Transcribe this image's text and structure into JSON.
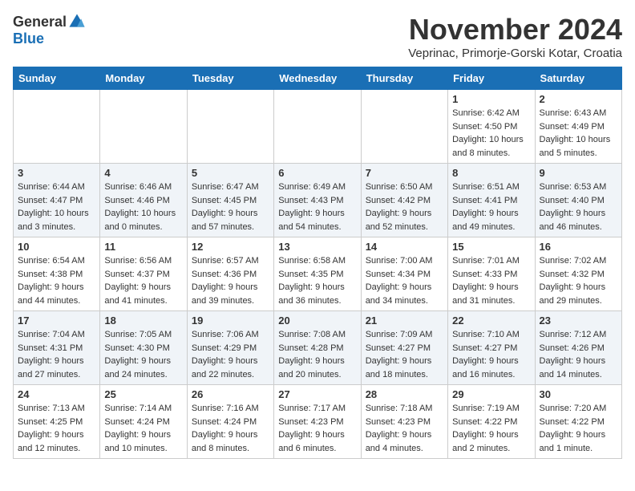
{
  "logo": {
    "general": "General",
    "blue": "Blue"
  },
  "title": "November 2024",
  "location": "Veprinac, Primorje-Gorski Kotar, Croatia",
  "days_header": [
    "Sunday",
    "Monday",
    "Tuesday",
    "Wednesday",
    "Thursday",
    "Friday",
    "Saturday"
  ],
  "weeks": [
    [
      {
        "day": "",
        "info": ""
      },
      {
        "day": "",
        "info": ""
      },
      {
        "day": "",
        "info": ""
      },
      {
        "day": "",
        "info": ""
      },
      {
        "day": "",
        "info": ""
      },
      {
        "day": "1",
        "info": "Sunrise: 6:42 AM\nSunset: 4:50 PM\nDaylight: 10 hours and 8 minutes."
      },
      {
        "day": "2",
        "info": "Sunrise: 6:43 AM\nSunset: 4:49 PM\nDaylight: 10 hours and 5 minutes."
      }
    ],
    [
      {
        "day": "3",
        "info": "Sunrise: 6:44 AM\nSunset: 4:47 PM\nDaylight: 10 hours and 3 minutes."
      },
      {
        "day": "4",
        "info": "Sunrise: 6:46 AM\nSunset: 4:46 PM\nDaylight: 10 hours and 0 minutes."
      },
      {
        "day": "5",
        "info": "Sunrise: 6:47 AM\nSunset: 4:45 PM\nDaylight: 9 hours and 57 minutes."
      },
      {
        "day": "6",
        "info": "Sunrise: 6:49 AM\nSunset: 4:43 PM\nDaylight: 9 hours and 54 minutes."
      },
      {
        "day": "7",
        "info": "Sunrise: 6:50 AM\nSunset: 4:42 PM\nDaylight: 9 hours and 52 minutes."
      },
      {
        "day": "8",
        "info": "Sunrise: 6:51 AM\nSunset: 4:41 PM\nDaylight: 9 hours and 49 minutes."
      },
      {
        "day": "9",
        "info": "Sunrise: 6:53 AM\nSunset: 4:40 PM\nDaylight: 9 hours and 46 minutes."
      }
    ],
    [
      {
        "day": "10",
        "info": "Sunrise: 6:54 AM\nSunset: 4:38 PM\nDaylight: 9 hours and 44 minutes."
      },
      {
        "day": "11",
        "info": "Sunrise: 6:56 AM\nSunset: 4:37 PM\nDaylight: 9 hours and 41 minutes."
      },
      {
        "day": "12",
        "info": "Sunrise: 6:57 AM\nSunset: 4:36 PM\nDaylight: 9 hours and 39 minutes."
      },
      {
        "day": "13",
        "info": "Sunrise: 6:58 AM\nSunset: 4:35 PM\nDaylight: 9 hours and 36 minutes."
      },
      {
        "day": "14",
        "info": "Sunrise: 7:00 AM\nSunset: 4:34 PM\nDaylight: 9 hours and 34 minutes."
      },
      {
        "day": "15",
        "info": "Sunrise: 7:01 AM\nSunset: 4:33 PM\nDaylight: 9 hours and 31 minutes."
      },
      {
        "day": "16",
        "info": "Sunrise: 7:02 AM\nSunset: 4:32 PM\nDaylight: 9 hours and 29 minutes."
      }
    ],
    [
      {
        "day": "17",
        "info": "Sunrise: 7:04 AM\nSunset: 4:31 PM\nDaylight: 9 hours and 27 minutes."
      },
      {
        "day": "18",
        "info": "Sunrise: 7:05 AM\nSunset: 4:30 PM\nDaylight: 9 hours and 24 minutes."
      },
      {
        "day": "19",
        "info": "Sunrise: 7:06 AM\nSunset: 4:29 PM\nDaylight: 9 hours and 22 minutes."
      },
      {
        "day": "20",
        "info": "Sunrise: 7:08 AM\nSunset: 4:28 PM\nDaylight: 9 hours and 20 minutes."
      },
      {
        "day": "21",
        "info": "Sunrise: 7:09 AM\nSunset: 4:27 PM\nDaylight: 9 hours and 18 minutes."
      },
      {
        "day": "22",
        "info": "Sunrise: 7:10 AM\nSunset: 4:27 PM\nDaylight: 9 hours and 16 minutes."
      },
      {
        "day": "23",
        "info": "Sunrise: 7:12 AM\nSunset: 4:26 PM\nDaylight: 9 hours and 14 minutes."
      }
    ],
    [
      {
        "day": "24",
        "info": "Sunrise: 7:13 AM\nSunset: 4:25 PM\nDaylight: 9 hours and 12 minutes."
      },
      {
        "day": "25",
        "info": "Sunrise: 7:14 AM\nSunset: 4:24 PM\nDaylight: 9 hours and 10 minutes."
      },
      {
        "day": "26",
        "info": "Sunrise: 7:16 AM\nSunset: 4:24 PM\nDaylight: 9 hours and 8 minutes."
      },
      {
        "day": "27",
        "info": "Sunrise: 7:17 AM\nSunset: 4:23 PM\nDaylight: 9 hours and 6 minutes."
      },
      {
        "day": "28",
        "info": "Sunrise: 7:18 AM\nSunset: 4:23 PM\nDaylight: 9 hours and 4 minutes."
      },
      {
        "day": "29",
        "info": "Sunrise: 7:19 AM\nSunset: 4:22 PM\nDaylight: 9 hours and 2 minutes."
      },
      {
        "day": "30",
        "info": "Sunrise: 7:20 AM\nSunset: 4:22 PM\nDaylight: 9 hours and 1 minute."
      }
    ]
  ]
}
